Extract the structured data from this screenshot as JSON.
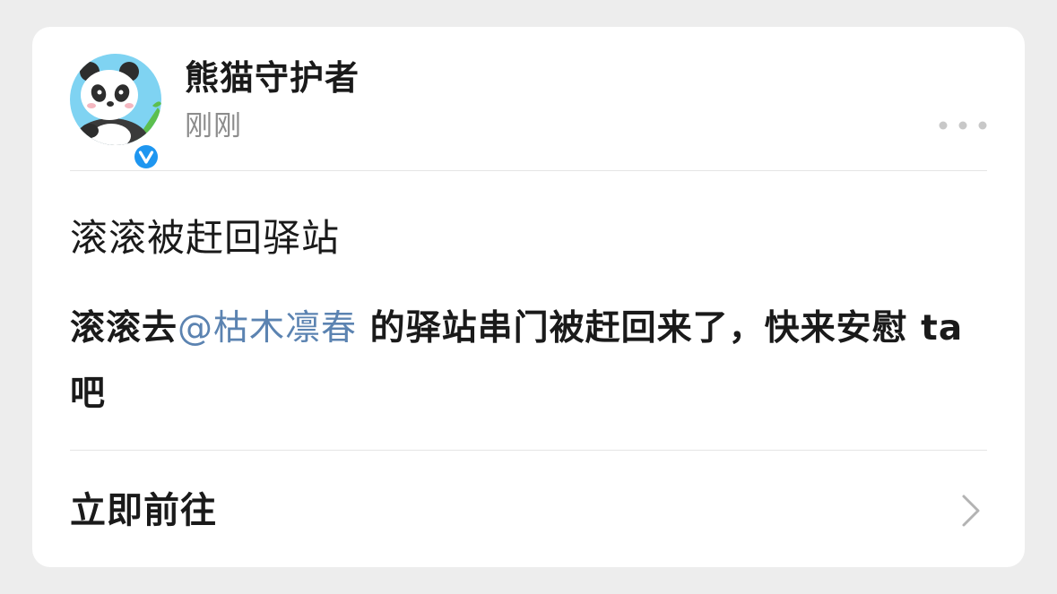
{
  "post": {
    "author_name": "熊猫守护者",
    "timestamp": "刚刚",
    "verified": true,
    "title": "滚滚被赶回驿站",
    "body_prefix": "滚滚去",
    "mention": "@枯木凛春",
    "body_suffix": " 的驿站串门被赶回来了，快来安慰 ta 吧"
  },
  "action": {
    "label": "立即前往"
  },
  "icons": {
    "avatar": "panda-avatar",
    "verified": "verified-badge-icon",
    "more": "more-dots-icon",
    "chevron": "chevron-right-icon"
  },
  "colors": {
    "mention": "#5b83b1",
    "verified": "#1e96f0",
    "background": "#ededed",
    "card": "#ffffff"
  }
}
